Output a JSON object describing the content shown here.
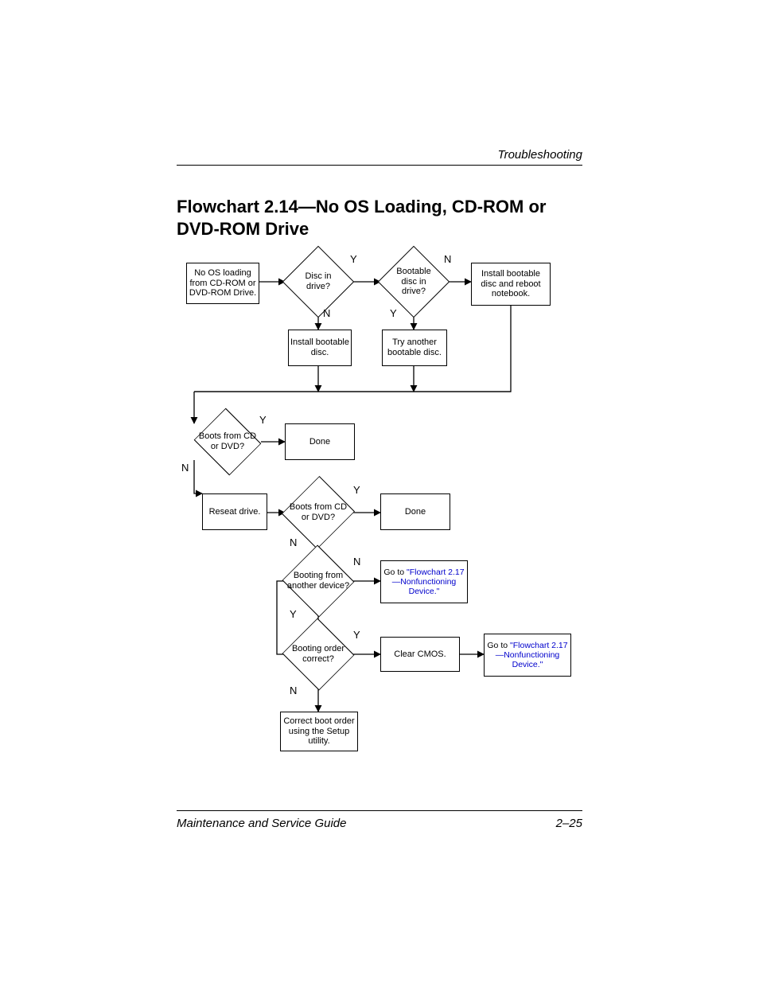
{
  "header": {
    "section": "Troubleshooting"
  },
  "title": "Flowchart 2.14—No OS Loading, CD-ROM or DVD-ROM Drive",
  "footer": {
    "left": "Maintenance and Service Guide",
    "right": "2–25"
  },
  "labels": {
    "Y": "Y",
    "N": "N"
  },
  "nodes": {
    "start": "No OS loading from CD-ROM or DVD-ROM Drive.",
    "discInDrive": "Disc in drive?",
    "bootableInDrive": "Bootable disc in drive?",
    "installReboot": "Install bootable disc and reboot notebook.",
    "installBootable": "Install bootable disc.",
    "tryAnother": "Try another bootable disc.",
    "boots1": "Boots from CD or DVD?",
    "done1": "Done",
    "reseat": "Reseat drive.",
    "boots2": "Boots from CD or DVD?",
    "done2": "Done",
    "bootingAnother": "Booting from another device?",
    "goto217a_pre": "Go to ",
    "goto217a_link": "\"Flowchart 2.17—Nonfunctioning Device.\"",
    "bootingOrder": "Booting order correct?",
    "clearCmos": "Clear CMOS.",
    "goto217b_pre": "Go to ",
    "goto217b_link": "\"Flowchart 2.17—Nonfunctioning Device.\"",
    "correctBoot": "Correct boot order using the Setup utility."
  },
  "chart_data": {
    "type": "flowchart",
    "title": "Flowchart 2.14—No OS Loading, CD-ROM or DVD-ROM Drive",
    "nodes": [
      {
        "id": "start",
        "kind": "process",
        "text": "No OS loading from CD-ROM or DVD-ROM Drive."
      },
      {
        "id": "discInDrive",
        "kind": "decision",
        "text": "Disc in drive?"
      },
      {
        "id": "bootableInDrive",
        "kind": "decision",
        "text": "Bootable disc in drive?"
      },
      {
        "id": "installReboot",
        "kind": "process",
        "text": "Install bootable disc and reboot notebook."
      },
      {
        "id": "installBootable",
        "kind": "process",
        "text": "Install bootable disc."
      },
      {
        "id": "tryAnother",
        "kind": "process",
        "text": "Try another bootable disc."
      },
      {
        "id": "boots1",
        "kind": "decision",
        "text": "Boots from CD or DVD?"
      },
      {
        "id": "done1",
        "kind": "terminator",
        "text": "Done"
      },
      {
        "id": "reseat",
        "kind": "process",
        "text": "Reseat drive."
      },
      {
        "id": "boots2",
        "kind": "decision",
        "text": "Boots from CD or DVD?"
      },
      {
        "id": "done2",
        "kind": "terminator",
        "text": "Done"
      },
      {
        "id": "bootingAnother",
        "kind": "decision",
        "text": "Booting from another device?"
      },
      {
        "id": "goto217a",
        "kind": "reference",
        "text": "Go to \"Flowchart 2.17—Nonfunctioning Device.\""
      },
      {
        "id": "bootingOrder",
        "kind": "decision",
        "text": "Booting order correct?"
      },
      {
        "id": "clearCmos",
        "kind": "process",
        "text": "Clear CMOS."
      },
      {
        "id": "goto217b",
        "kind": "reference",
        "text": "Go to \"Flowchart 2.17—Nonfunctioning Device.\""
      },
      {
        "id": "correctBoot",
        "kind": "process",
        "text": "Correct boot order using the Setup utility."
      }
    ],
    "edges": [
      {
        "from": "start",
        "to": "discInDrive"
      },
      {
        "from": "discInDrive",
        "to": "bootableInDrive",
        "label": "Y"
      },
      {
        "from": "discInDrive",
        "to": "installBootable",
        "label": "N"
      },
      {
        "from": "bootableInDrive",
        "to": "installReboot",
        "label": "N"
      },
      {
        "from": "bootableInDrive",
        "to": "tryAnother",
        "label": "Y"
      },
      {
        "from": "installReboot",
        "to": "mergeA"
      },
      {
        "from": "installBootable",
        "to": "mergeA"
      },
      {
        "from": "tryAnother",
        "to": "mergeA"
      },
      {
        "from": "mergeA",
        "to": "boots1"
      },
      {
        "from": "boots1",
        "to": "done1",
        "label": "Y"
      },
      {
        "from": "boots1",
        "to": "reseat",
        "label": "N"
      },
      {
        "from": "reseat",
        "to": "boots2"
      },
      {
        "from": "boots2",
        "to": "done2",
        "label": "Y"
      },
      {
        "from": "boots2",
        "to": "bootingAnother",
        "label": "N"
      },
      {
        "from": "bootingAnother",
        "to": "goto217a",
        "label": "N"
      },
      {
        "from": "bootingAnother",
        "to": "bootingOrder",
        "label": "Y"
      },
      {
        "from": "bootingOrder",
        "to": "clearCmos",
        "label": "Y"
      },
      {
        "from": "bootingOrder",
        "to": "correctBoot",
        "label": "N"
      },
      {
        "from": "clearCmos",
        "to": "goto217b"
      }
    ]
  }
}
